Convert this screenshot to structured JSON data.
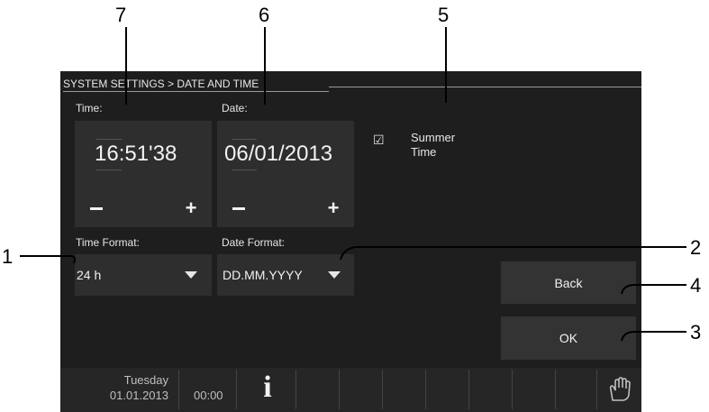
{
  "breadcrumb": "SYSTEM SETTINGS > DATE AND TIME",
  "time": {
    "label": "Time:",
    "value": "16:51'38",
    "minus": "−",
    "plus": "+"
  },
  "date": {
    "label": "Date:",
    "value": "06/01/2013",
    "minus": "−",
    "plus": "+"
  },
  "summer_time": {
    "checked": true,
    "check_glyph": "☑",
    "label_line1": "Summer",
    "label_line2": "Time"
  },
  "time_format": {
    "label": "Time Format:",
    "value": "24 h"
  },
  "date_format": {
    "label": "Date Format:",
    "value": "DD.MM.YYYY"
  },
  "buttons": {
    "back": "Back",
    "ok": "OK"
  },
  "status_bar": {
    "day": "Tuesday",
    "date": "01.01.2013",
    "time": "00:00",
    "info_icon": "i",
    "hand_icon": "hand-icon"
  },
  "callouts": {
    "c1": "1",
    "c2": "2",
    "c3": "3",
    "c4": "4",
    "c5": "5",
    "c6": "6",
    "c7": "7"
  },
  "colors": {
    "screen_bg": "#1e1e1e",
    "panel_bg": "#2e2e2e",
    "text": "#f2f2f2"
  }
}
